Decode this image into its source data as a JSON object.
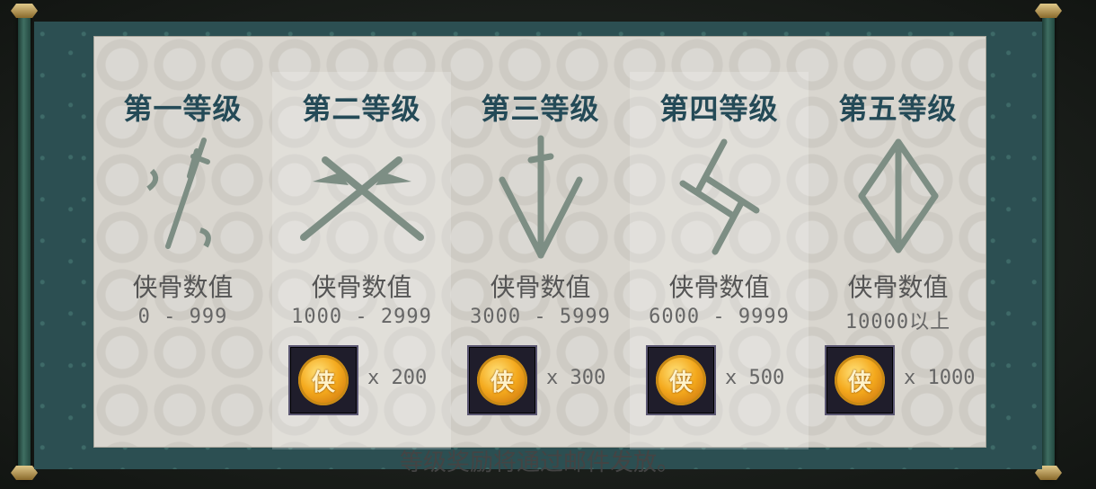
{
  "tiers": [
    {
      "title": "第一等级",
      "label": "侠骨数值",
      "range": "0 - 999",
      "reward": null
    },
    {
      "title": "第二等级",
      "label": "侠骨数值",
      "range": "1000 - 2999",
      "reward": {
        "icon": "coin-xia-icon",
        "glyph": "侠",
        "qty": "x 200"
      }
    },
    {
      "title": "第三等级",
      "label": "侠骨数值",
      "range": "3000 - 5999",
      "reward": {
        "icon": "coin-xia-icon",
        "glyph": "侠",
        "qty": "x 300"
      }
    },
    {
      "title": "第四等级",
      "label": "侠骨数值",
      "range": "6000 - 9999",
      "reward": {
        "icon": "coin-xia-icon",
        "glyph": "侠",
        "qty": "x 500"
      }
    },
    {
      "title": "第五等级",
      "label": "侠骨数值",
      "range": "10000以上",
      "reward": {
        "icon": "coin-xia-icon",
        "glyph": "侠",
        "qty": "x 1000"
      }
    }
  ],
  "footer": "等级奖励将通过邮件发放。",
  "colors": {
    "title": "#244a57",
    "paper": "#d9d6cf",
    "border": "#2c4f52",
    "coin": "#f4a91d"
  }
}
